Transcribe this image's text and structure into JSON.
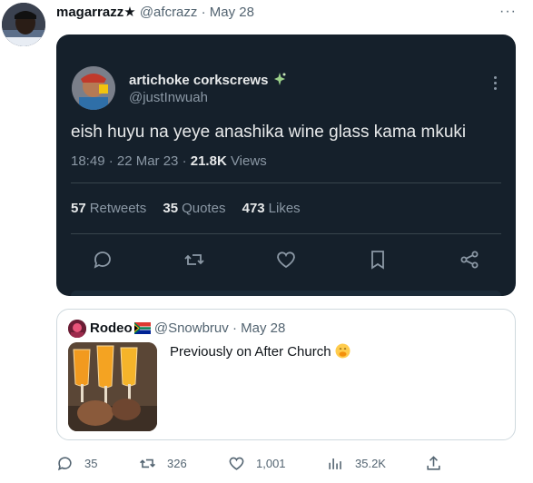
{
  "tweet": {
    "author_name": "magarrazz★",
    "author_handle": "@afcrazz",
    "date": "· May 28",
    "more_icon": "more-horizontal-icon"
  },
  "embedded_screenshot": {
    "author_name": "artichoke corkscrews",
    "author_badge_icon": "sparkle-emoji-icon",
    "author_handle": "@justInwuah",
    "text": "eish huyu na yeye anashika wine glass kama mkuki",
    "time": "18:49 · 22 Mar 23 ·",
    "views_count": "21.8K",
    "views_label": "Views",
    "stats": [
      {
        "count": "57",
        "label": "Retweets"
      },
      {
        "count": "35",
        "label": "Quotes"
      },
      {
        "count": "473",
        "label": "Likes"
      }
    ],
    "colors": {
      "background": "#15202b",
      "text": "#e7e9ea",
      "muted": "#8b98a5",
      "accent": "#1d9bf0"
    }
  },
  "quoted_tweet": {
    "author_name": "Rodeo",
    "flag_icon": "south-africa-flag-icon",
    "author_handle": "@Snowbruv",
    "date": "· May 28",
    "text": "Previously on After Church",
    "emoji_icon": "smiling-face-hand-over-mouth-emoji",
    "image": "photo-of-mimosa-glasses"
  },
  "actions": {
    "replies": "35",
    "retweets": "326",
    "likes": "1,001",
    "views": "35.2K"
  }
}
